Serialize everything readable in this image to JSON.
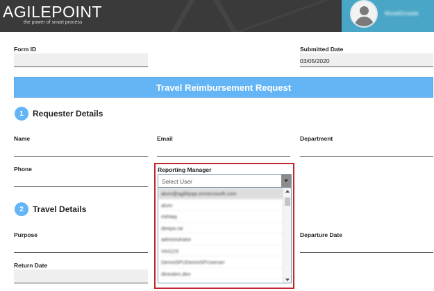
{
  "header": {
    "logo_text": "AGILEPOINT",
    "logo_tagline": "the power of smart process",
    "user_name": "MuraliGroada"
  },
  "form": {
    "form_id": {
      "label": "Form ID",
      "value": ""
    },
    "submitted_date": {
      "label": "Submitted Date",
      "value": "03/05/2020"
    },
    "title": "Travel Reimbursement Request"
  },
  "sections": [
    {
      "number": "1",
      "title": "Requester Details"
    },
    {
      "number": "2",
      "title": "Travel Details"
    }
  ],
  "requester": {
    "name_label": "Name",
    "email_label": "Email",
    "department_label": "Department",
    "phone_label": "Phone"
  },
  "travel": {
    "purpose_label": "Purpose",
    "departure_date_label": "Departure Date",
    "return_date_label": "Return Date"
  },
  "reporting_manager": {
    "label": "Reporting Manager",
    "selected": "Select User",
    "options": [
      "alum@agilityqa.onmicrosoft.com",
      "alum",
      "rishtaq",
      "deepa.rai",
      "administrator",
      "Vini123",
      "DemoSPUDemoSPUserser",
      "dinesbm.dev"
    ]
  },
  "colors": {
    "header_bg": "#3a3a3a",
    "user_panel_bg": "#49a6c6",
    "accent_blue": "#64b5f6",
    "highlight_border": "#c0262d"
  }
}
